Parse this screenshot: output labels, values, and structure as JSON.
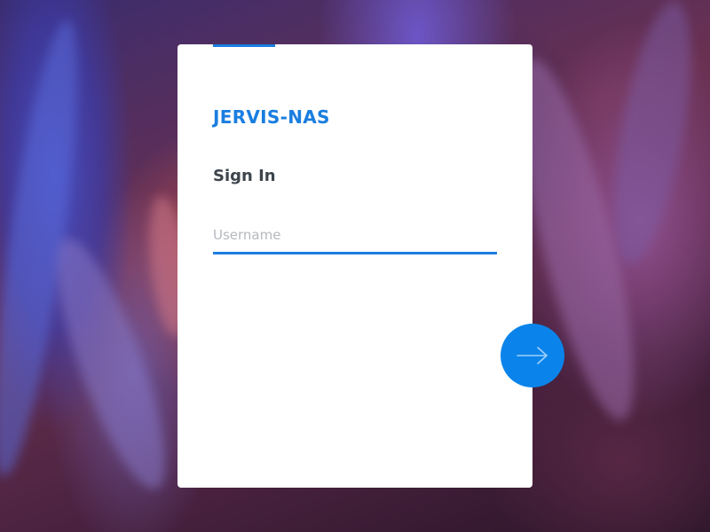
{
  "background": {
    "description_colors": [
      "#3a2c6e",
      "#6a3050",
      "#4a2240",
      "#2a1528"
    ]
  },
  "login": {
    "server_name": "JERVIS-NAS",
    "heading": "Sign In",
    "username_placeholder": "Username",
    "username_value": ""
  },
  "actions": {
    "next_icon": "arrow-right-icon"
  },
  "colors": {
    "accent": "#1a7ee0",
    "button": "#0a84ea",
    "heading_text": "#3d444c",
    "placeholder": "#b5b9be",
    "card": "#ffffff"
  }
}
